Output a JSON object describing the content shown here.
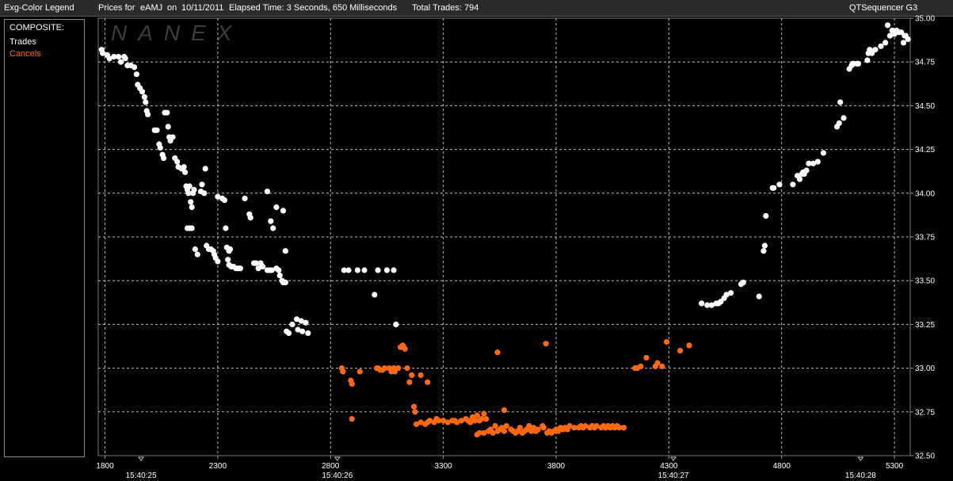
{
  "header": {
    "legend_title": "Exg-Color Legend",
    "prices_label": "Prices for",
    "symbol": "eAMJ",
    "on_label": "on",
    "date": "10/11/2011",
    "elapsed": "Elapsed Time: 3 Seconds, 650 Milliseconds",
    "total_trades": "Total Trades: 794",
    "app_name": "QTSequencer G3"
  },
  "legend": {
    "heading": "COMPOSITE:",
    "items": [
      {
        "label": "Trades",
        "color": "#ffffff"
      },
      {
        "label": "Cancels",
        "color": "#ff6a10"
      }
    ]
  },
  "watermark": "NANEX",
  "chart_data": {
    "type": "scatter",
    "title": "",
    "xlabel": "",
    "ylabel": "",
    "xlim": [
      1770,
      5370
    ],
    "ylim": [
      32.5,
      35.0
    ],
    "x_ticks": [
      1800,
      2300,
      2800,
      3300,
      3800,
      4300,
      4800,
      5300
    ],
    "y_ticks": [
      32.5,
      32.75,
      33.0,
      33.25,
      33.5,
      33.75,
      34.0,
      34.25,
      34.5,
      34.75,
      35.0
    ],
    "y_tick_labels": [
      "32.50",
      "32.75",
      "33.00",
      "33.25",
      "33.50",
      "33.75",
      "34.00",
      "34.25",
      "34.50",
      "34.75",
      "35.00"
    ],
    "time_labels": [
      {
        "x": 1960,
        "label": "15:40:25"
      },
      {
        "x": 2830,
        "label": "15:40:26"
      },
      {
        "x": 4320,
        "label": "15:40:27"
      },
      {
        "x": 5150,
        "label": "15:40:28"
      }
    ],
    "grid": true,
    "series": [
      {
        "name": "Trades",
        "color": "#ffffff",
        "points": [
          [
            1785,
            34.82
          ],
          [
            1790,
            34.8
          ],
          [
            1810,
            34.79
          ],
          [
            1820,
            34.77
          ],
          [
            1840,
            34.78
          ],
          [
            1860,
            34.78
          ],
          [
            1870,
            34.75
          ],
          [
            1885,
            34.78
          ],
          [
            1890,
            34.77
          ],
          [
            1900,
            34.73
          ],
          [
            1915,
            34.73
          ],
          [
            1930,
            34.72
          ],
          [
            1940,
            34.68
          ],
          [
            1945,
            34.62
          ],
          [
            1955,
            34.6
          ],
          [
            1965,
            34.58
          ],
          [
            1975,
            34.55
          ],
          [
            1980,
            34.52
          ],
          [
            1985,
            34.47
          ],
          [
            1990,
            34.45
          ],
          [
            2020,
            34.36
          ],
          [
            2030,
            34.36
          ],
          [
            2040,
            34.28
          ],
          [
            2045,
            34.26
          ],
          [
            2055,
            34.22
          ],
          [
            2060,
            34.2
          ],
          [
            2065,
            34.46
          ],
          [
            2075,
            34.46
          ],
          [
            2080,
            34.38
          ],
          [
            2085,
            34.32
          ],
          [
            2090,
            34.3
          ],
          [
            2100,
            34.32
          ],
          [
            2110,
            34.2
          ],
          [
            2120,
            34.18
          ],
          [
            2125,
            34.15
          ],
          [
            2140,
            34.14
          ],
          [
            2150,
            34.15
          ],
          [
            2155,
            34.12
          ],
          [
            2160,
            34.04
          ],
          [
            2165,
            34.02
          ],
          [
            2170,
            34.0
          ],
          [
            2175,
            34.04
          ],
          [
            2180,
            33.95
          ],
          [
            2185,
            33.92
          ],
          [
            2190,
            34.0
          ],
          [
            2195,
            34.02
          ],
          [
            2165,
            33.8
          ],
          [
            2175,
            33.8
          ],
          [
            2185,
            33.8
          ],
          [
            2200,
            33.68
          ],
          [
            2210,
            33.65
          ],
          [
            2225,
            34.01
          ],
          [
            2230,
            34.05
          ],
          [
            2240,
            34.0
          ],
          [
            2245,
            34.14
          ],
          [
            2250,
            33.7
          ],
          [
            2260,
            33.68
          ],
          [
            2270,
            33.68
          ],
          [
            2280,
            33.67
          ],
          [
            2285,
            33.65
          ],
          [
            2290,
            33.63
          ],
          [
            2300,
            33.61
          ],
          [
            2300,
            33.98
          ],
          [
            2320,
            33.97
          ],
          [
            2330,
            33.96
          ],
          [
            2335,
            33.8
          ],
          [
            2340,
            33.69
          ],
          [
            2345,
            33.62
          ],
          [
            2350,
            33.59
          ],
          [
            2360,
            33.58
          ],
          [
            2370,
            33.58
          ],
          [
            2380,
            33.57
          ],
          [
            2390,
            33.57
          ],
          [
            2395,
            33.57
          ],
          [
            2400,
            33.57
          ],
          [
            2350,
            33.67
          ],
          [
            2355,
            33.68
          ],
          [
            2420,
            33.97
          ],
          [
            2440,
            33.88
          ],
          [
            2445,
            33.86
          ],
          [
            2460,
            33.6
          ],
          [
            2470,
            33.6
          ],
          [
            2480,
            33.57
          ],
          [
            2490,
            33.6
          ],
          [
            2500,
            33.58
          ],
          [
            2520,
            33.56
          ],
          [
            2530,
            33.56
          ],
          [
            2540,
            33.56
          ],
          [
            2520,
            34.01
          ],
          [
            2535,
            33.84
          ],
          [
            2545,
            33.8
          ],
          [
            2560,
            33.57
          ],
          [
            2570,
            33.56
          ],
          [
            2575,
            33.53
          ],
          [
            2585,
            33.5
          ],
          [
            2590,
            33.49
          ],
          [
            2600,
            33.49
          ],
          [
            2560,
            33.92
          ],
          [
            2590,
            33.9
          ],
          [
            2600,
            33.67
          ],
          [
            2605,
            33.21
          ],
          [
            2615,
            33.2
          ],
          [
            2630,
            33.25
          ],
          [
            2650,
            33.28
          ],
          [
            2655,
            33.22
          ],
          [
            2670,
            33.27
          ],
          [
            2675,
            33.21
          ],
          [
            2690,
            33.26
          ],
          [
            2700,
            33.2
          ],
          [
            2860,
            33.56
          ],
          [
            2880,
            33.56
          ],
          [
            2920,
            33.56
          ],
          [
            2950,
            33.56
          ],
          [
            2995,
            33.42
          ],
          [
            3010,
            33.56
          ],
          [
            3050,
            33.56
          ],
          [
            3080,
            33.56
          ],
          [
            3090,
            33.25
          ],
          [
            4445,
            33.37
          ],
          [
            4470,
            33.36
          ],
          [
            4490,
            33.36
          ],
          [
            4510,
            33.37
          ],
          [
            4520,
            33.37
          ],
          [
            4530,
            33.38
          ],
          [
            4545,
            33.4
          ],
          [
            4555,
            33.42
          ],
          [
            4575,
            33.43
          ],
          [
            4620,
            33.48
          ],
          [
            4630,
            33.49
          ],
          [
            4700,
            33.41
          ],
          [
            4720,
            33.67
          ],
          [
            4725,
            33.7
          ],
          [
            4730,
            33.87
          ],
          [
            4760,
            34.03
          ],
          [
            4765,
            34.03
          ],
          [
            4790,
            34.05
          ],
          [
            4850,
            34.05
          ],
          [
            4870,
            34.1
          ],
          [
            4880,
            34.08
          ],
          [
            4890,
            34.11
          ],
          [
            4895,
            34.12
          ],
          [
            4900,
            34.11
          ],
          [
            4910,
            34.13
          ],
          [
            4920,
            34.17
          ],
          [
            4940,
            34.17
          ],
          [
            4960,
            34.18
          ],
          [
            4985,
            34.23
          ],
          [
            5045,
            34.38
          ],
          [
            5055,
            34.4
          ],
          [
            5060,
            34.52
          ],
          [
            5075,
            34.43
          ],
          [
            5100,
            34.71
          ],
          [
            5110,
            34.73
          ],
          [
            5115,
            34.74
          ],
          [
            5120,
            34.74
          ],
          [
            5135,
            34.74
          ],
          [
            5140,
            34.74
          ],
          [
            5180,
            34.76
          ],
          [
            5185,
            34.8
          ],
          [
            5190,
            34.82
          ],
          [
            5200,
            34.8
          ],
          [
            5215,
            34.82
          ],
          [
            5240,
            34.84
          ],
          [
            5260,
            34.86
          ],
          [
            5270,
            34.96
          ],
          [
            5280,
            34.9
          ],
          [
            5290,
            34.93
          ],
          [
            5300,
            34.91
          ],
          [
            5310,
            34.93
          ],
          [
            5320,
            34.92
          ],
          [
            5330,
            34.92
          ],
          [
            5340,
            34.86
          ],
          [
            5345,
            34.9
          ],
          [
            5350,
            34.9
          ],
          [
            5360,
            34.88
          ]
        ]
      },
      {
        "name": "Cancels",
        "color": "#ff6a10",
        "points": [
          [
            2850,
            33.0
          ],
          [
            2855,
            32.98
          ],
          [
            2890,
            32.93
          ],
          [
            2895,
            32.91
          ],
          [
            2895,
            32.71
          ],
          [
            2930,
            32.98
          ],
          [
            3005,
            33.0
          ],
          [
            3010,
            33.0
          ],
          [
            3020,
            32.99
          ],
          [
            3030,
            32.99
          ],
          [
            3040,
            33.0
          ],
          [
            3060,
            33.0
          ],
          [
            3070,
            32.98
          ],
          [
            3080,
            33.0
          ],
          [
            3085,
            32.98
          ],
          [
            3100,
            33.0
          ],
          [
            3110,
            33.12
          ],
          [
            3120,
            33.13
          ],
          [
            3125,
            33.12
          ],
          [
            3130,
            33.11
          ],
          [
            3140,
            33.0
          ],
          [
            3150,
            32.92
          ],
          [
            3160,
            32.96
          ],
          [
            3170,
            32.78
          ],
          [
            3175,
            32.75
          ],
          [
            3180,
            32.68
          ],
          [
            3200,
            32.96
          ],
          [
            3230,
            32.92
          ],
          [
            3200,
            32.69
          ],
          [
            3220,
            32.68
          ],
          [
            3230,
            32.69
          ],
          [
            3240,
            32.7
          ],
          [
            3260,
            32.69
          ],
          [
            3270,
            32.71
          ],
          [
            3280,
            32.7
          ],
          [
            3300,
            32.7
          ],
          [
            3320,
            32.69
          ],
          [
            3340,
            32.7
          ],
          [
            3350,
            32.7
          ],
          [
            3360,
            32.69
          ],
          [
            3380,
            32.7
          ],
          [
            3400,
            32.71
          ],
          [
            3410,
            32.7
          ],
          [
            3420,
            32.69
          ],
          [
            3430,
            32.72
          ],
          [
            3440,
            32.7
          ],
          [
            3450,
            32.73
          ],
          [
            3460,
            32.7
          ],
          [
            3470,
            32.71
          ],
          [
            3480,
            32.74
          ],
          [
            3490,
            32.71
          ],
          [
            3450,
            32.62
          ],
          [
            3460,
            32.63
          ],
          [
            3480,
            32.63
          ],
          [
            3500,
            32.64
          ],
          [
            3510,
            32.65
          ],
          [
            3520,
            32.63
          ],
          [
            3530,
            32.67
          ],
          [
            3540,
            32.64
          ],
          [
            3550,
            32.65
          ],
          [
            3560,
            32.66
          ],
          [
            3570,
            32.64
          ],
          [
            3580,
            32.67
          ],
          [
            3600,
            32.65
          ],
          [
            3610,
            32.64
          ],
          [
            3620,
            32.63
          ],
          [
            3630,
            32.64
          ],
          [
            3640,
            32.66
          ],
          [
            3650,
            32.63
          ],
          [
            3660,
            32.64
          ],
          [
            3670,
            32.65
          ],
          [
            3680,
            32.67
          ],
          [
            3690,
            32.64
          ],
          [
            3700,
            32.66
          ],
          [
            3710,
            32.64
          ],
          [
            3720,
            32.65
          ],
          [
            3740,
            32.67
          ],
          [
            3745,
            32.66
          ],
          [
            3760,
            32.63
          ],
          [
            3770,
            32.64
          ],
          [
            3780,
            32.63
          ],
          [
            3790,
            32.64
          ],
          [
            3800,
            32.65
          ],
          [
            3810,
            32.64
          ],
          [
            3820,
            32.66
          ],
          [
            3830,
            32.65
          ],
          [
            3840,
            32.66
          ],
          [
            3850,
            32.65
          ],
          [
            3860,
            32.67
          ],
          [
            3880,
            32.66
          ],
          [
            3900,
            32.66
          ],
          [
            3910,
            32.67
          ],
          [
            3920,
            32.66
          ],
          [
            3930,
            32.67
          ],
          [
            3950,
            32.66
          ],
          [
            3960,
            32.67
          ],
          [
            3970,
            32.66
          ],
          [
            3980,
            32.67
          ],
          [
            4000,
            32.66
          ],
          [
            4010,
            32.67
          ],
          [
            4020,
            32.66
          ],
          [
            4030,
            32.67
          ],
          [
            4040,
            32.66
          ],
          [
            4050,
            32.67
          ],
          [
            4060,
            32.66
          ],
          [
            4070,
            32.67
          ],
          [
            4080,
            32.66
          ],
          [
            4100,
            32.66
          ],
          [
            3540,
            33.09
          ],
          [
            3570,
            32.76
          ],
          [
            3755,
            33.14
          ],
          [
            4150,
            33.0
          ],
          [
            4160,
            33.0
          ],
          [
            4175,
            33.01
          ],
          [
            4200,
            33.06
          ],
          [
            4240,
            33.01
          ],
          [
            4250,
            33.03
          ],
          [
            4270,
            33.01
          ],
          [
            4290,
            33.15
          ],
          [
            4350,
            33.1
          ],
          [
            4390,
            33.13
          ]
        ]
      }
    ]
  }
}
